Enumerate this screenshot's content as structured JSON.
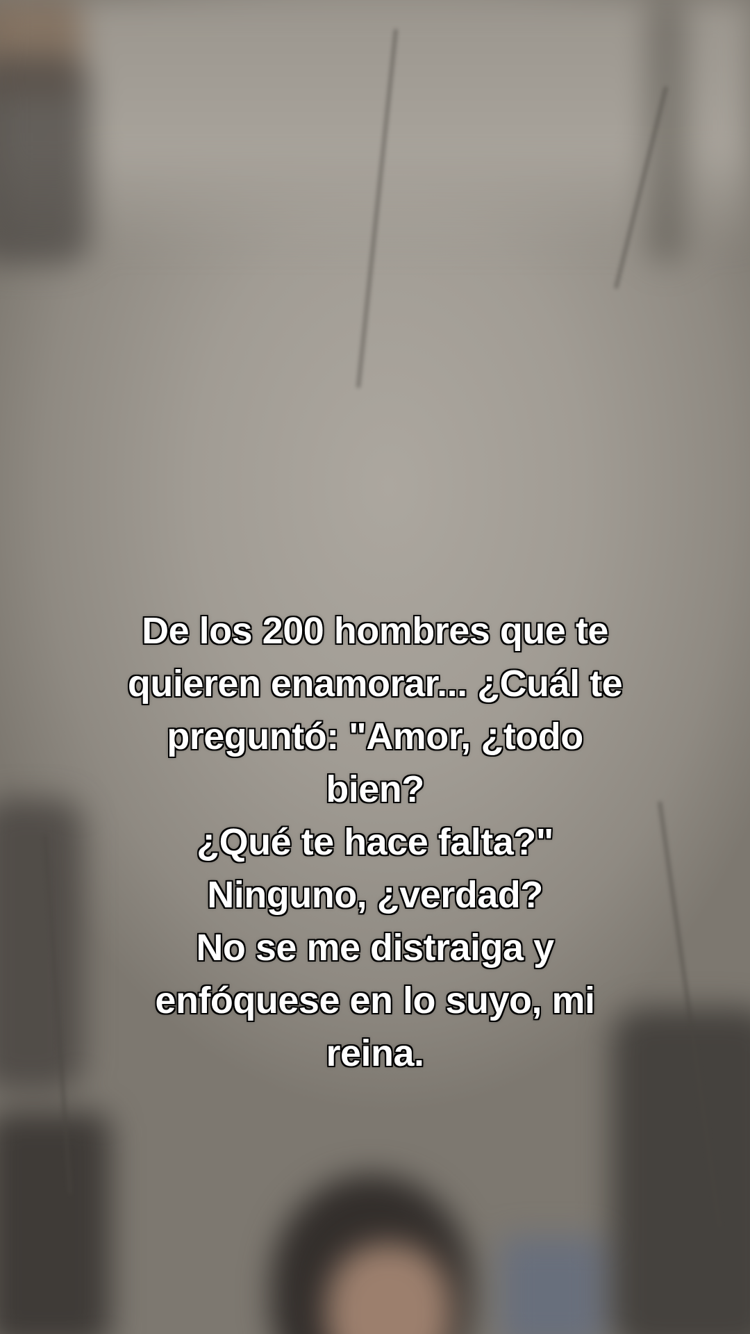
{
  "caption": {
    "lines": [
      "De los 200 hombres que te",
      "quieren enamorar... ¿Cuál te",
      "preguntó: \"Amor, ¿todo",
      "bien?",
      "¿Qué te hace falta?\"",
      "Ninguno, ¿verdad?",
      "No se me distraiga y",
      "enfóquese en lo suyo, mi",
      "reina."
    ]
  }
}
